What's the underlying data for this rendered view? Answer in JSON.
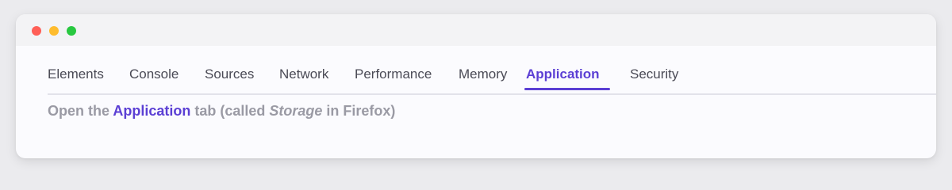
{
  "window": {
    "traffic_lights": [
      "close",
      "minimize",
      "zoom"
    ]
  },
  "tabs": [
    {
      "label": "Elements",
      "active": false
    },
    {
      "label": "Console",
      "active": false
    },
    {
      "label": "Sources",
      "active": false
    },
    {
      "label": "Network",
      "active": false
    },
    {
      "label": "Performance",
      "active": false
    },
    {
      "label": "Memory",
      "active": false
    },
    {
      "label": "Application",
      "active": true
    },
    {
      "label": "Security",
      "active": false
    }
  ],
  "instruction": {
    "part1": "Open the ",
    "highlight": "Application",
    "part2": " tab (called ",
    "italic": "Storage",
    "part3": " in Firefox)"
  },
  "colors": {
    "accent": "#5b3fd4",
    "muted_text": "#9a9aa4",
    "tab_text": "#4a4a55",
    "traffic_red": "#ff5f57",
    "traffic_yellow": "#febc2e",
    "traffic_green": "#28c840"
  }
}
